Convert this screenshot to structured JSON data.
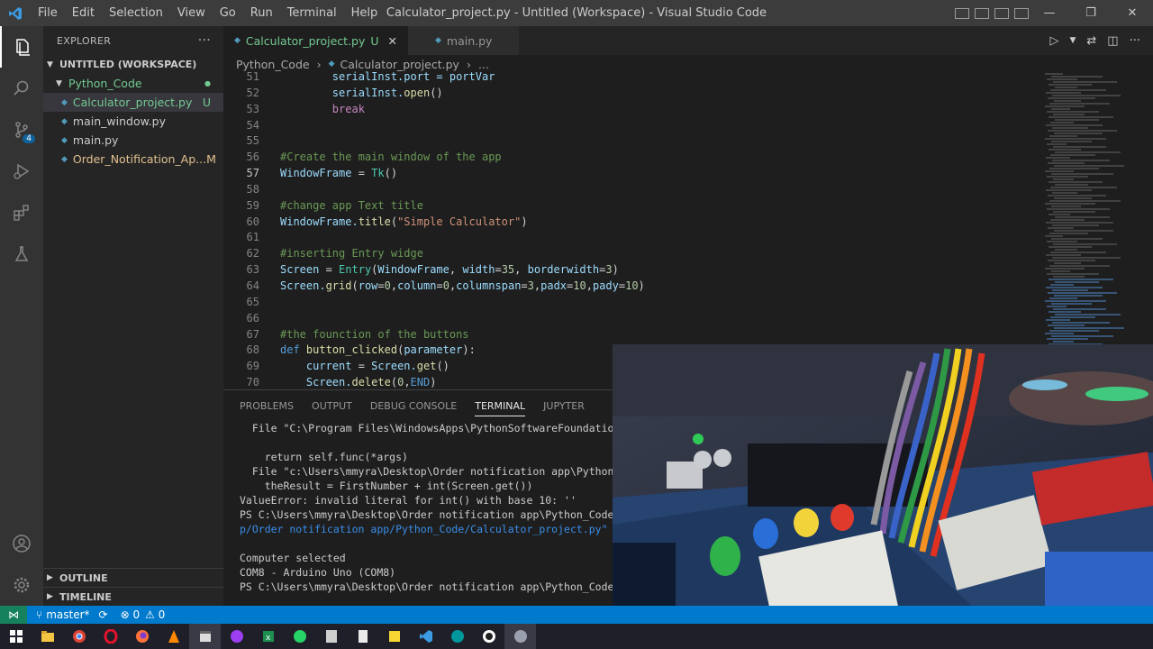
{
  "titlebar": {
    "menu": [
      "File",
      "Edit",
      "Selection",
      "View",
      "Go",
      "Run",
      "Terminal",
      "Help"
    ],
    "title": "Calculator_project.py - Untitled (Workspace) - Visual Studio Code",
    "controls": [
      "—",
      "❐",
      "✕"
    ]
  },
  "activity_bar": {
    "source_control_badge": "4"
  },
  "sidebar": {
    "header": "EXPLORER",
    "more": "···",
    "workspace": "UNTITLED (WORKSPACE)",
    "folder": "Python_Code",
    "files": [
      {
        "name": "Calculator_project.py",
        "status": "U"
      },
      {
        "name": "main_window.py",
        "status": ""
      },
      {
        "name": "main.py",
        "status": ""
      },
      {
        "name": "Order_Notification_Ap...",
        "status": "M"
      }
    ],
    "outline": "OUTLINE",
    "timeline": "TIMELINE"
  },
  "editor": {
    "tabs": [
      {
        "label": "Calculator_project.py",
        "status": "U",
        "close": "✕"
      },
      {
        "label": "main.py"
      }
    ],
    "breadcrumb": [
      "Python_Code",
      "Calculator_project.py",
      "..."
    ],
    "code_lines": [
      {
        "n": "51",
        "tokens": [
          {
            "t": "        serialInst.port = portVar",
            "c": "var"
          }
        ]
      },
      {
        "n": "52",
        "tokens": [
          {
            "t": "        serialInst.",
            "c": "var"
          },
          {
            "t": "open",
            "c": "fn"
          },
          {
            "t": "()",
            "c": "pl"
          }
        ]
      },
      {
        "n": "53",
        "tokens": [
          {
            "t": "        break",
            "c": "kw"
          }
        ]
      },
      {
        "n": "54",
        "tokens": []
      },
      {
        "n": "55",
        "tokens": []
      },
      {
        "n": "56",
        "tokens": [
          {
            "t": "#Create the main window of the app",
            "c": "cm"
          }
        ]
      },
      {
        "n": "57",
        "tokens": [
          {
            "t": "WindowFrame",
            "c": "var"
          },
          {
            "t": " = ",
            "c": "pl"
          },
          {
            "t": "Tk",
            "c": "cls"
          },
          {
            "t": "()",
            "c": "pl"
          }
        ]
      },
      {
        "n": "58",
        "tokens": []
      },
      {
        "n": "59",
        "tokens": [
          {
            "t": "#change app Text title",
            "c": "cm"
          }
        ]
      },
      {
        "n": "60",
        "tokens": [
          {
            "t": "WindowFrame.",
            "c": "var"
          },
          {
            "t": "title",
            "c": "fn"
          },
          {
            "t": "(",
            "c": "pl"
          },
          {
            "t": "\"Simple Calculator\"",
            "c": "str"
          },
          {
            "t": ")",
            "c": "pl"
          }
        ]
      },
      {
        "n": "61",
        "tokens": []
      },
      {
        "n": "62",
        "tokens": [
          {
            "t": "#inserting Entry widge",
            "c": "cm"
          }
        ]
      },
      {
        "n": "63",
        "tokens": [
          {
            "t": "Screen",
            "c": "var"
          },
          {
            "t": " = ",
            "c": "pl"
          },
          {
            "t": "Entry",
            "c": "cls"
          },
          {
            "t": "(",
            "c": "pl"
          },
          {
            "t": "WindowFrame",
            "c": "var"
          },
          {
            "t": ", ",
            "c": "pl"
          },
          {
            "t": "width",
            "c": "var"
          },
          {
            "t": "=",
            "c": "pl"
          },
          {
            "t": "35",
            "c": "num"
          },
          {
            "t": ", ",
            "c": "pl"
          },
          {
            "t": "borderwidth",
            "c": "var"
          },
          {
            "t": "=",
            "c": "pl"
          },
          {
            "t": "3",
            "c": "num"
          },
          {
            "t": ")",
            "c": "pl"
          }
        ]
      },
      {
        "n": "64",
        "tokens": [
          {
            "t": "Screen.",
            "c": "var"
          },
          {
            "t": "grid",
            "c": "fn"
          },
          {
            "t": "(",
            "c": "pl"
          },
          {
            "t": "row",
            "c": "var"
          },
          {
            "t": "=",
            "c": "pl"
          },
          {
            "t": "0",
            "c": "num"
          },
          {
            "t": ",",
            "c": "pl"
          },
          {
            "t": "column",
            "c": "var"
          },
          {
            "t": "=",
            "c": "pl"
          },
          {
            "t": "0",
            "c": "num"
          },
          {
            "t": ",",
            "c": "pl"
          },
          {
            "t": "columnspan",
            "c": "var"
          },
          {
            "t": "=",
            "c": "pl"
          },
          {
            "t": "3",
            "c": "num"
          },
          {
            "t": ",",
            "c": "pl"
          },
          {
            "t": "padx",
            "c": "var"
          },
          {
            "t": "=",
            "c": "pl"
          },
          {
            "t": "10",
            "c": "num"
          },
          {
            "t": ",",
            "c": "pl"
          },
          {
            "t": "pady",
            "c": "var"
          },
          {
            "t": "=",
            "c": "pl"
          },
          {
            "t": "10",
            "c": "num"
          },
          {
            "t": ")",
            "c": "pl"
          }
        ]
      },
      {
        "n": "65",
        "tokens": []
      },
      {
        "n": "66",
        "tokens": []
      },
      {
        "n": "67",
        "tokens": [
          {
            "t": "#the founction of the buttons",
            "c": "cm"
          }
        ]
      },
      {
        "n": "68",
        "tokens": [
          {
            "t": "def",
            "c": "kw2"
          },
          {
            "t": " ",
            "c": "pl"
          },
          {
            "t": "button_clicked",
            "c": "fn"
          },
          {
            "t": "(",
            "c": "pl"
          },
          {
            "t": "parameter",
            "c": "var"
          },
          {
            "t": "):",
            "c": "pl"
          }
        ]
      },
      {
        "n": "69",
        "tokens": [
          {
            "t": "    current",
            "c": "var"
          },
          {
            "t": " = ",
            "c": "pl"
          },
          {
            "t": "Screen.",
            "c": "var"
          },
          {
            "t": "get",
            "c": "fn"
          },
          {
            "t": "()",
            "c": "pl"
          }
        ]
      },
      {
        "n": "70",
        "tokens": [
          {
            "t": "    Screen.",
            "c": "var"
          },
          {
            "t": "delete",
            "c": "fn"
          },
          {
            "t": "(",
            "c": "pl"
          },
          {
            "t": "0",
            "c": "num"
          },
          {
            "t": ",",
            "c": "pl"
          },
          {
            "t": "END",
            "c": "kw2"
          },
          {
            "t": ")",
            "c": "pl"
          }
        ]
      }
    ],
    "current_line": "57"
  },
  "panel": {
    "tabs": [
      "PROBLEMS",
      "OUTPUT",
      "DEBUG CONSOLE",
      "TERMINAL",
      "JUPYTER"
    ],
    "active_tab": "TERMINAL",
    "terminal_lines": [
      {
        "text": "  File \"C:\\Program Files\\WindowsApps\\PythonSoftwareFoundation.P",
        "style": ""
      },
      {
        "text": "",
        "style": ""
      },
      {
        "text": "    return self.func(*args)",
        "style": ""
      },
      {
        "text": "  File \"c:\\Users\\mmyra\\Desktop\\Order notification app\\Python_Co",
        "style": ""
      },
      {
        "text": "    theResult = FirstNumber + int(Screen.get())",
        "style": ""
      },
      {
        "text": "ValueError: invalid literal for int() with base 10: ''",
        "style": ""
      },
      {
        "text": "PS C:\\Users\\mmyra\\Desktop\\Order notification app\\Python_Code> &",
        "style": ""
      },
      {
        "text": "p/Order notification app/Python_Code/Calculator_project.py\"",
        "style": "blue"
      },
      {
        "text": "",
        "style": ""
      },
      {
        "text": "Computer selected",
        "style": ""
      },
      {
        "text": "COM8 - Arduino Uno (COM8)",
        "style": ""
      },
      {
        "text": "PS C:\\Users\\mmyra\\Desktop\\Order notification app\\Python_Code> ",
        "style": "prompt"
      }
    ]
  },
  "statusbar": {
    "branch": "master*",
    "sync": "⟳",
    "errors": "⊗ 0",
    "warnings": "⚠ 0"
  },
  "colors": {
    "accent": "#007acc",
    "untracked": "#73c991",
    "modified": "#e2c08d"
  }
}
